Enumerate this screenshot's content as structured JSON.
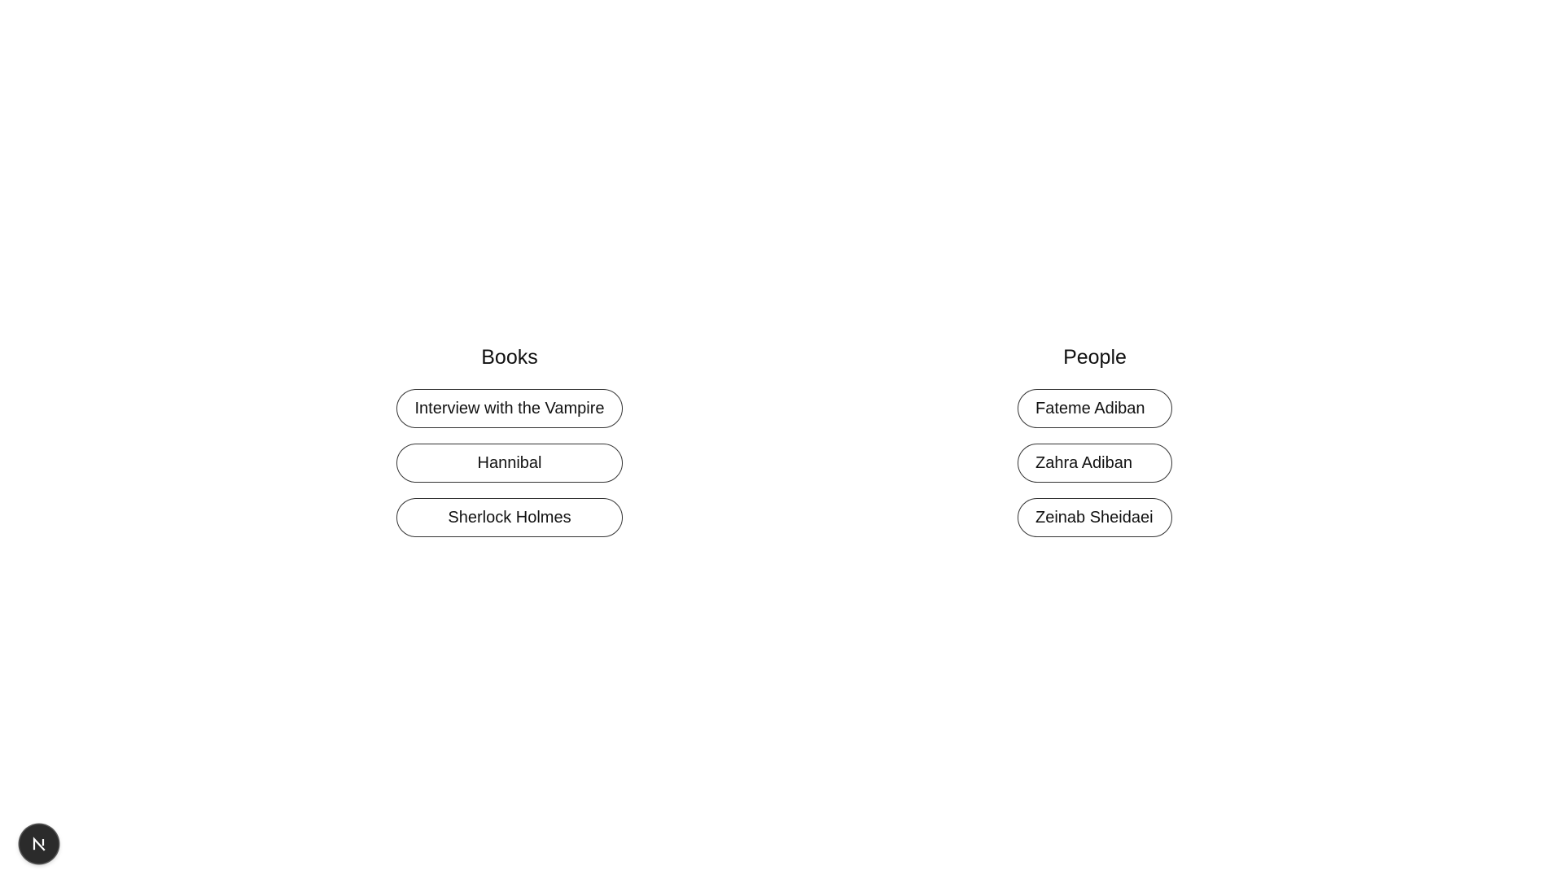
{
  "books": {
    "heading": "Books",
    "items": [
      {
        "label": "Interview with the Vampire"
      },
      {
        "label": "Hannibal"
      },
      {
        "label": "Sherlock Holmes"
      }
    ]
  },
  "people": {
    "heading": "People",
    "items": [
      {
        "label": "Fateme Adiban"
      },
      {
        "label": "Zahra Adiban"
      },
      {
        "label": "Zeinab Sheidaei"
      }
    ]
  },
  "dev_indicator": {
    "icon": "nextjs-logo-icon",
    "letter": "N"
  }
}
